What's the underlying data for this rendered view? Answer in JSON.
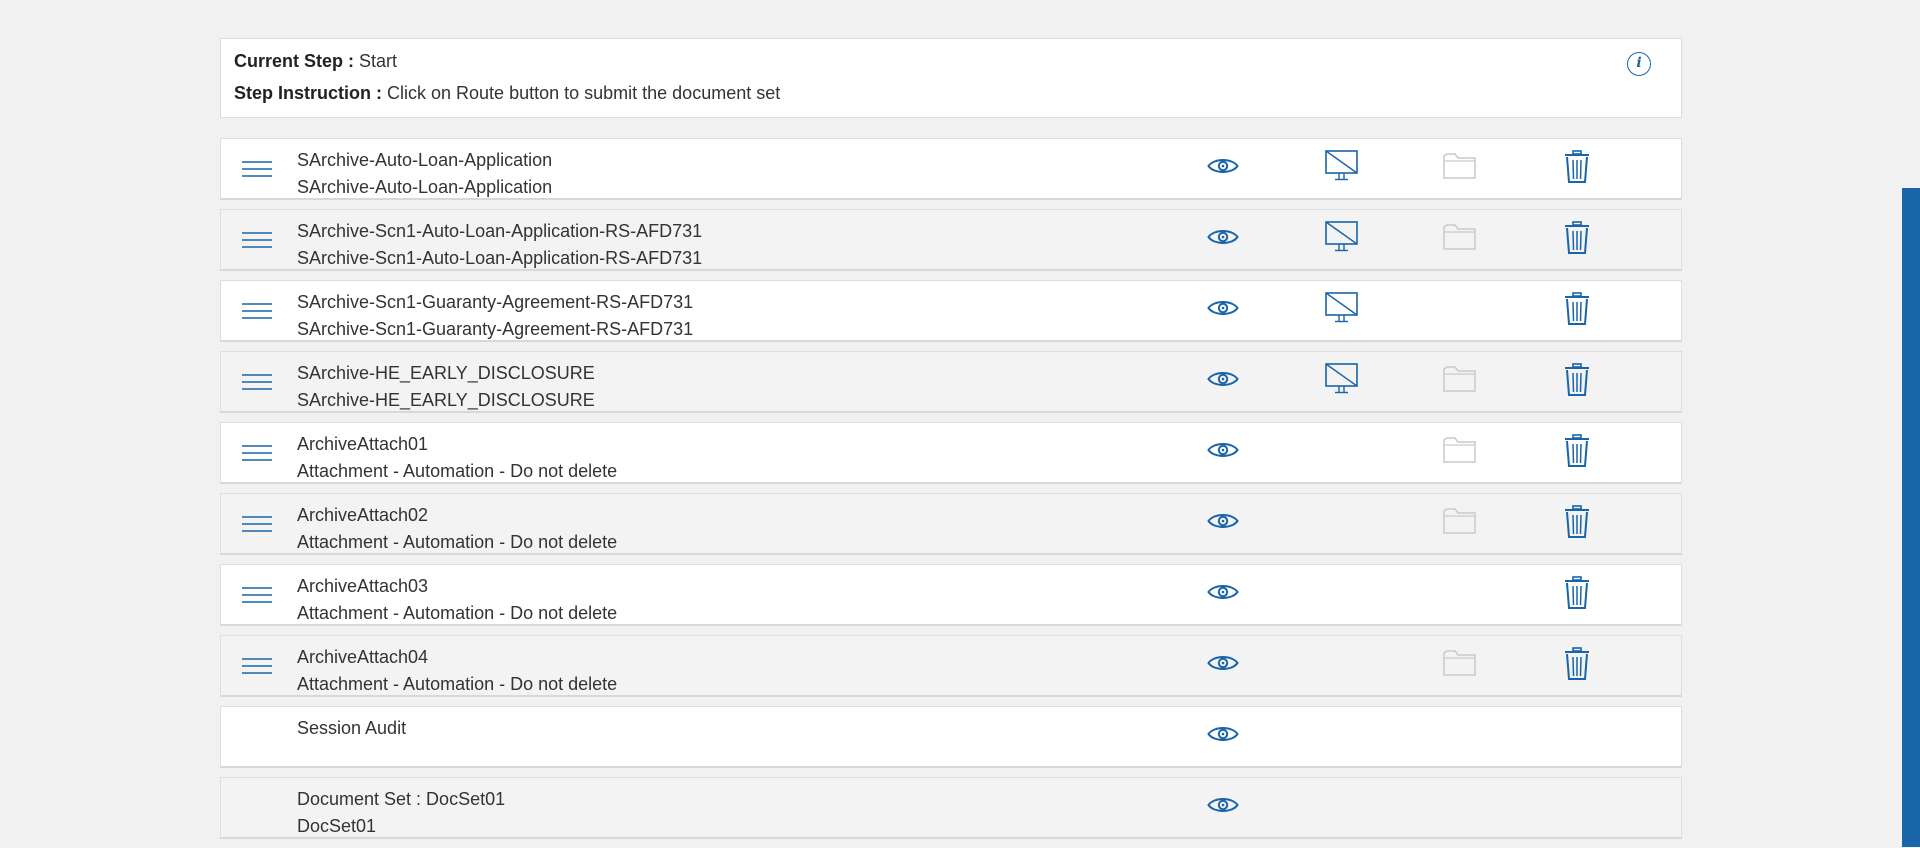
{
  "step": {
    "current_label": "Current Step :",
    "current_value": "Start",
    "instruction_label": "Step Instruction :",
    "instruction_value": "Click on Route button to submit the document set"
  },
  "info_icon": "info-icon",
  "colors": {
    "accent": "#1a64a8",
    "folder": "#c9c9c9",
    "row_alt": "#f3f3f3"
  },
  "documents": [
    {
      "line1": "SArchive-Auto-Loan-Application",
      "line2": "SArchive-Auto-Loan-Application",
      "draggable": true,
      "view": true,
      "monitor": true,
      "folder": true,
      "delete": true
    },
    {
      "line1": "SArchive-Scn1-Auto-Loan-Application-RS-AFD731",
      "line2": "SArchive-Scn1-Auto-Loan-Application-RS-AFD731",
      "draggable": true,
      "view": true,
      "monitor": true,
      "folder": true,
      "delete": true
    },
    {
      "line1": "SArchive-Scn1-Guaranty-Agreement-RS-AFD731",
      "line2": "SArchive-Scn1-Guaranty-Agreement-RS-AFD731",
      "draggable": true,
      "view": true,
      "monitor": true,
      "folder": false,
      "delete": true
    },
    {
      "line1": "SArchive-HE_EARLY_DISCLOSURE",
      "line2": "SArchive-HE_EARLY_DISCLOSURE",
      "draggable": true,
      "view": true,
      "monitor": true,
      "folder": true,
      "delete": true
    },
    {
      "line1": "ArchiveAttach01",
      "line2": "Attachment - Automation - Do not delete",
      "draggable": true,
      "view": true,
      "monitor": false,
      "folder": true,
      "delete": true
    },
    {
      "line1": "ArchiveAttach02",
      "line2": "Attachment - Automation - Do not delete",
      "draggable": true,
      "view": true,
      "monitor": false,
      "folder": true,
      "delete": true
    },
    {
      "line1": "ArchiveAttach03",
      "line2": "Attachment - Automation - Do not delete",
      "draggable": true,
      "view": true,
      "monitor": false,
      "folder": false,
      "delete": true
    },
    {
      "line1": "ArchiveAttach04",
      "line2": "Attachment - Automation - Do not delete",
      "draggable": true,
      "view": true,
      "monitor": false,
      "folder": true,
      "delete": true
    },
    {
      "line1": "Session Audit",
      "line2": "",
      "draggable": false,
      "view": true,
      "monitor": false,
      "folder": false,
      "delete": false
    },
    {
      "line1": "Document Set : DocSet01",
      "line2": "DocSet01",
      "draggable": false,
      "view": true,
      "monitor": false,
      "folder": false,
      "delete": false
    }
  ]
}
